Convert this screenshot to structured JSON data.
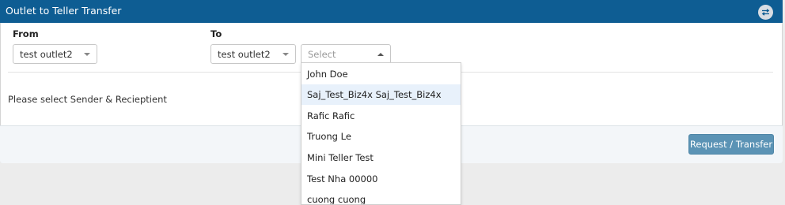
{
  "header": {
    "title": "Outlet to Teller Transfer",
    "toggle_icon": "swap-icon"
  },
  "from": {
    "label": "From",
    "outlet_value": "test outlet2"
  },
  "to": {
    "label": "To",
    "outlet_value": "test outlet2",
    "teller_placeholder": "Select"
  },
  "message": "Please select Sender & Recieptient",
  "footer": {
    "submit_label": "Request / Transfer"
  },
  "teller_dropdown": {
    "highlighted": "Saj_Test_Biz4x Saj_Test_Biz4x",
    "options": [
      "John Doe",
      "Saj_Test_Biz4x Saj_Test_Biz4x",
      "Rafic Rafic",
      "Truong Le",
      "Mini Teller Test",
      "Test Nha 00000",
      "cuong cuong"
    ]
  },
  "colors": {
    "header_bg": "#0e5d93",
    "button_bg": "#5b93b5",
    "highlight_bg": "#e8f1fb"
  }
}
